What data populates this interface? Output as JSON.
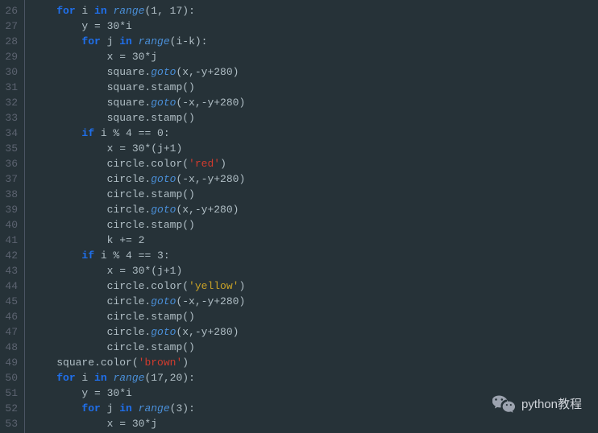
{
  "watermark": {
    "text": "python教程"
  },
  "gutter": {
    "start": 26,
    "end": 53
  },
  "lines": [
    {
      "n": 26,
      "indent": 1,
      "tokens": [
        [
          "kw",
          "for"
        ],
        [
          "plain",
          " i "
        ],
        [
          "kw",
          "in"
        ],
        [
          "plain",
          " "
        ],
        [
          "fn",
          "range"
        ],
        [
          "plain",
          "(1, 17):"
        ]
      ]
    },
    {
      "n": 27,
      "indent": 2,
      "tokens": [
        [
          "plain",
          "y = 30*i"
        ]
      ]
    },
    {
      "n": 28,
      "indent": 2,
      "tokens": [
        [
          "kw",
          "for"
        ],
        [
          "plain",
          " j "
        ],
        [
          "kw",
          "in"
        ],
        [
          "plain",
          " "
        ],
        [
          "fn",
          "range"
        ],
        [
          "plain",
          "(i-k):"
        ]
      ]
    },
    {
      "n": 29,
      "indent": 3,
      "tokens": [
        [
          "plain",
          "x = 30*j"
        ]
      ]
    },
    {
      "n": 30,
      "indent": 3,
      "tokens": [
        [
          "plain",
          "square."
        ],
        [
          "meth",
          "goto"
        ],
        [
          "plain",
          "(x,-y+280)"
        ]
      ]
    },
    {
      "n": 31,
      "indent": 3,
      "tokens": [
        [
          "plain",
          "square.stamp()"
        ]
      ]
    },
    {
      "n": 32,
      "indent": 3,
      "tokens": [
        [
          "plain",
          "square."
        ],
        [
          "meth",
          "goto"
        ],
        [
          "plain",
          "(-x,-y+280)"
        ]
      ]
    },
    {
      "n": 33,
      "indent": 3,
      "tokens": [
        [
          "plain",
          "square.stamp()"
        ]
      ]
    },
    {
      "n": 34,
      "indent": 2,
      "tokens": [
        [
          "kw",
          "if"
        ],
        [
          "plain",
          " i % 4 == 0:"
        ]
      ]
    },
    {
      "n": 35,
      "indent": 3,
      "tokens": [
        [
          "plain",
          "x = 30*(j+1)"
        ]
      ]
    },
    {
      "n": 36,
      "indent": 3,
      "tokens": [
        [
          "plain",
          "circle.color("
        ],
        [
          "str",
          "'red'"
        ],
        [
          "plain",
          ")"
        ]
      ]
    },
    {
      "n": 37,
      "indent": 3,
      "tokens": [
        [
          "plain",
          "circle."
        ],
        [
          "meth",
          "goto"
        ],
        [
          "plain",
          "(-x,-y+280)"
        ]
      ]
    },
    {
      "n": 38,
      "indent": 3,
      "tokens": [
        [
          "plain",
          "circle.stamp()"
        ]
      ]
    },
    {
      "n": 39,
      "indent": 3,
      "tokens": [
        [
          "plain",
          "circle."
        ],
        [
          "meth",
          "goto"
        ],
        [
          "plain",
          "(x,-y+280)"
        ]
      ]
    },
    {
      "n": 40,
      "indent": 3,
      "tokens": [
        [
          "plain",
          "circle.stamp()"
        ]
      ]
    },
    {
      "n": 41,
      "indent": 3,
      "tokens": [
        [
          "plain",
          "k += 2"
        ]
      ]
    },
    {
      "n": 42,
      "indent": 2,
      "tokens": [
        [
          "kw",
          "if"
        ],
        [
          "plain",
          " i % 4 == 3:"
        ]
      ]
    },
    {
      "n": 43,
      "indent": 3,
      "tokens": [
        [
          "plain",
          "x = 30*(j+1)"
        ]
      ]
    },
    {
      "n": 44,
      "indent": 3,
      "tokens": [
        [
          "plain",
          "circle.color("
        ],
        [
          "str2",
          "'yellow'"
        ],
        [
          "plain",
          ")"
        ]
      ]
    },
    {
      "n": 45,
      "indent": 3,
      "tokens": [
        [
          "plain",
          "circle."
        ],
        [
          "meth",
          "goto"
        ],
        [
          "plain",
          "(-x,-y+280)"
        ]
      ]
    },
    {
      "n": 46,
      "indent": 3,
      "tokens": [
        [
          "plain",
          "circle.stamp()"
        ]
      ]
    },
    {
      "n": 47,
      "indent": 3,
      "tokens": [
        [
          "plain",
          "circle."
        ],
        [
          "meth",
          "goto"
        ],
        [
          "plain",
          "(x,-y+280)"
        ]
      ]
    },
    {
      "n": 48,
      "indent": 3,
      "tokens": [
        [
          "plain",
          "circle.stamp()"
        ]
      ]
    },
    {
      "n": 49,
      "indent": 1,
      "tokens": [
        [
          "plain",
          "square.color("
        ],
        [
          "str",
          "'brown'"
        ],
        [
          "plain",
          ")"
        ]
      ]
    },
    {
      "n": 50,
      "indent": 1,
      "tokens": [
        [
          "kw",
          "for"
        ],
        [
          "plain",
          " i "
        ],
        [
          "kw",
          "in"
        ],
        [
          "plain",
          " "
        ],
        [
          "fn",
          "range"
        ],
        [
          "plain",
          "(17,20):"
        ]
      ]
    },
    {
      "n": 51,
      "indent": 2,
      "tokens": [
        [
          "plain",
          "y = 30*i"
        ]
      ]
    },
    {
      "n": 52,
      "indent": 2,
      "tokens": [
        [
          "kw",
          "for"
        ],
        [
          "plain",
          " j "
        ],
        [
          "kw",
          "in"
        ],
        [
          "plain",
          " "
        ],
        [
          "fn",
          "range"
        ],
        [
          "plain",
          "(3):"
        ]
      ]
    },
    {
      "n": 53,
      "indent": 3,
      "tokens": [
        [
          "plain",
          "x = 30*j"
        ]
      ]
    }
  ]
}
